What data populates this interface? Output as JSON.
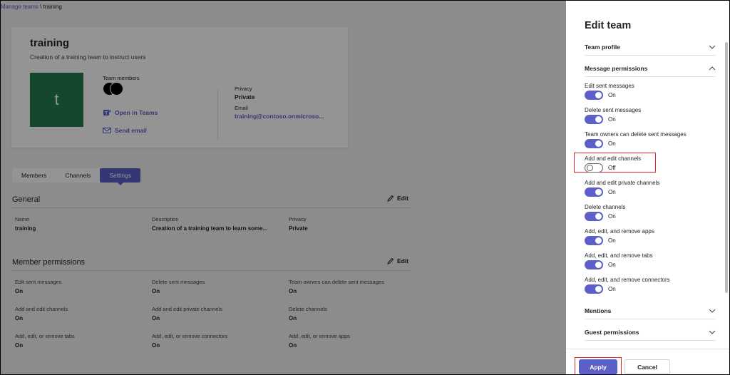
{
  "breadcrumb": {
    "link": "Manage teams",
    "separator": " \\ ",
    "current": "training"
  },
  "team": {
    "title": "training",
    "description": "Creation of a training team to instruct users",
    "avatar_letter": "t",
    "members_label": "Team members",
    "open_in_teams": "Open in Teams",
    "send_email": "Send email",
    "privacy_label": "Privacy",
    "privacy_value": "Private",
    "email_label": "Email",
    "email_value": "training@contoso.onmicroso..."
  },
  "tabs": [
    {
      "label": "Members"
    },
    {
      "label": "Channels"
    },
    {
      "label": "Settings",
      "active": true
    }
  ],
  "general": {
    "title": "General",
    "edit": "Edit",
    "name_label": "Name",
    "name_value": "training",
    "desc_label": "Description",
    "desc_value": "Creation of a training team to learn some...",
    "privacy_label": "Privacy",
    "privacy_value": "Private"
  },
  "member_permissions": {
    "title": "Member permissions",
    "edit": "Edit",
    "items": [
      {
        "label": "Edit sent messages",
        "value": "On"
      },
      {
        "label": "Delete sent messages",
        "value": "On"
      },
      {
        "label": "Team owners can delete sent messages",
        "value": "On"
      },
      {
        "label": "Add and edit channels",
        "value": "On"
      },
      {
        "label": "Add and edit private channels",
        "value": "On"
      },
      {
        "label": "Delete channels",
        "value": "On"
      },
      {
        "label": "Add, edit, or remove tabs",
        "value": "On"
      },
      {
        "label": "Add, edit, or remove connectors",
        "value": "On"
      },
      {
        "label": "Add, edit, or remove apps",
        "value": "On"
      }
    ]
  },
  "panel": {
    "title": "Edit team",
    "team_profile": "Team profile",
    "message_permissions": "Message permissions",
    "toggles": [
      {
        "label": "Edit sent messages",
        "state": "On"
      },
      {
        "label": "Delete sent messages",
        "state": "On"
      },
      {
        "label": "Team owners can delete sent messages",
        "state": "On"
      },
      {
        "label": "Add and edit channels",
        "state": "Off"
      },
      {
        "label": "Add and edit private channels",
        "state": "On"
      },
      {
        "label": "Delete channels",
        "state": "On"
      },
      {
        "label": "Add, edit, and remove apps",
        "state": "On"
      },
      {
        "label": "Add, edit, and remove tabs",
        "state": "On"
      },
      {
        "label": "Add, edit, and remove connectors",
        "state": "On"
      }
    ],
    "mentions": "Mentions",
    "guest_permissions": "Guest permissions",
    "apply": "Apply",
    "cancel": "Cancel"
  },
  "colors": {
    "accent": "#5b5fc7",
    "avatar_bg": "#237b4b",
    "highlight": "#e3262a"
  }
}
